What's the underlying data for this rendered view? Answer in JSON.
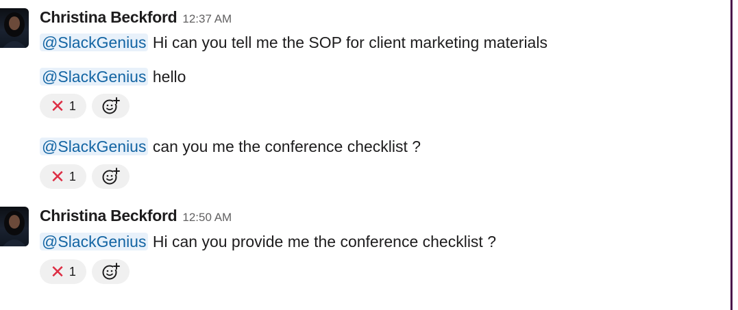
{
  "messages": [
    {
      "author": "Christina Beckford",
      "time": "12:37 AM",
      "lines": [
        {
          "mention": "@SlackGenius",
          "text": "Hi can you tell me the SOP for client marketing materials"
        },
        {
          "mention": "@SlackGenius",
          "text": "hello",
          "reaction": {
            "emoji": "x-icon",
            "count": "1"
          }
        },
        {
          "mention": "@SlackGenius",
          "text": "can you me the conference checklist ?",
          "reaction": {
            "emoji": "x-icon",
            "count": "1"
          }
        }
      ]
    },
    {
      "author": "Christina Beckford",
      "time": "12:50 AM",
      "lines": [
        {
          "mention": "@SlackGenius",
          "text": "Hi can you provide me the conference checklist ?",
          "reaction": {
            "emoji": "x-icon",
            "count": "1"
          }
        }
      ]
    }
  ],
  "colors": {
    "mention_bg": "#e8f1fa",
    "mention_text": "#1264a3",
    "reaction_bg": "#f0f0f0",
    "x_emoji": "#dd2e44",
    "sidebar_accent": "#4a154b"
  }
}
